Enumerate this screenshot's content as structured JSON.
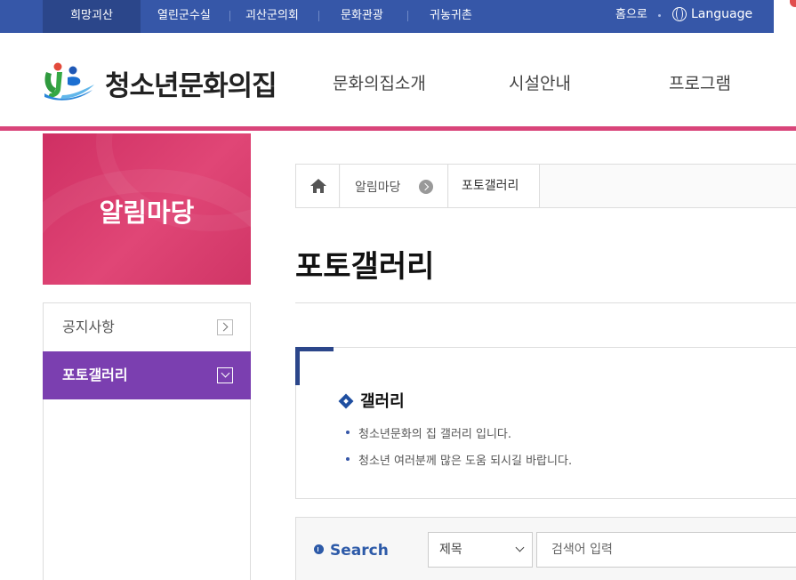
{
  "topbar": {
    "items": [
      "희망괴산",
      "열린군수실",
      "괴산군의회",
      "문화관광",
      "귀농귀촌"
    ],
    "home": "홈으로",
    "language": "Language"
  },
  "header": {
    "site_title": "청소년문화의집",
    "gnb": [
      "문화의집소개",
      "시설안내",
      "프로그램"
    ]
  },
  "sidebar": {
    "title": "알림마당",
    "items": [
      {
        "label": "공지사항"
      },
      {
        "label": "포토갤러리"
      }
    ]
  },
  "breadcrumb": {
    "parent": "알림마당",
    "current": "포토갤러리"
  },
  "page": {
    "title": "포토갤러리"
  },
  "info": {
    "heading": "갤러리",
    "lines": [
      "청소년문화의 집 갤러리 입니다.",
      "청소년 여러분께 많은 도움 되시길 바랍니다."
    ]
  },
  "search": {
    "label": "Search",
    "field": "제목",
    "placeholder": "검색어 입력"
  },
  "colors": {
    "topbar": "#3657a8",
    "accent_pink": "#d9457a",
    "active_purple": "#7b3fb0"
  }
}
